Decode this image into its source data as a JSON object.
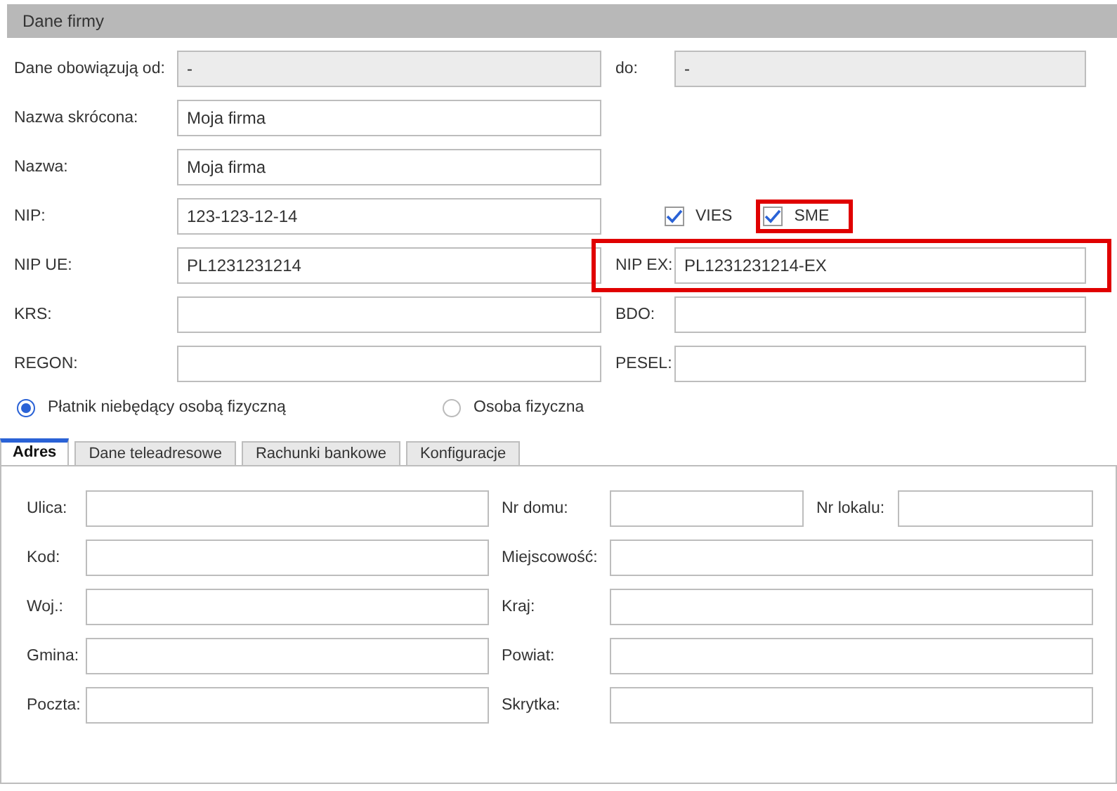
{
  "section_title": "Dane firmy",
  "rows": [
    {
      "items": [
        {
          "kind": "field",
          "label": "Dane obowiązują od:",
          "value": "-",
          "disabled": true
        },
        {
          "kind": "field",
          "label": "do:",
          "value": "-",
          "disabled": true
        }
      ]
    },
    {
      "items": [
        {
          "kind": "field",
          "label": "Nazwa skrócona:",
          "value": "Moja firma",
          "disabled": false
        }
      ]
    },
    {
      "items": [
        {
          "kind": "field",
          "label": "Nazwa:",
          "value": "Moja firma",
          "disabled": false
        }
      ]
    },
    {
      "items": [
        {
          "kind": "field",
          "label": "NIP:",
          "value": "123-123-12-14",
          "disabled": false
        },
        {
          "kind": "checks",
          "checks": [
            {
              "label": "VIES",
              "checked": true,
              "highlighted": false
            },
            {
              "label": "SME",
              "checked": true,
              "highlighted": true
            }
          ]
        }
      ]
    },
    {
      "items": [
        {
          "kind": "field",
          "label": "NIP UE:",
          "value": "PL1231231214",
          "disabled": false
        },
        {
          "kind": "field",
          "label": "NIP EX:",
          "value": "PL1231231214-EX",
          "disabled": false,
          "highlighted": true
        }
      ]
    },
    {
      "items": [
        {
          "kind": "field",
          "label": "KRS:",
          "disabled": false
        },
        {
          "kind": "field",
          "label": "BDO:",
          "disabled": false
        }
      ]
    },
    {
      "items": [
        {
          "kind": "field",
          "label": "REGON:",
          "disabled": false
        },
        {
          "kind": "field",
          "label": "PESEL:",
          "disabled": false
        }
      ]
    }
  ],
  "radios": [
    {
      "label": "Płatnik niebędący osobą fizyczną",
      "selected": true
    },
    {
      "label": "Osoba fizyczna",
      "selected": false
    }
  ],
  "tabs": [
    {
      "label": "Adres",
      "selected": true
    },
    {
      "label": "Dane teleadresowe",
      "selected": false
    },
    {
      "label": "Rachunki bankowe",
      "selected": false
    },
    {
      "label": "Konfiguracje",
      "selected": false
    }
  ],
  "address_rows": [
    {
      "fields": [
        {
          "label": "Ulica:"
        },
        {
          "label": "Nr domu:"
        },
        {
          "label": "Nr lokalu:"
        }
      ]
    },
    {
      "fields": [
        {
          "label": "Kod:"
        },
        {
          "label": "Miejscowość:"
        }
      ]
    },
    {
      "fields": [
        {
          "label": "Woj.:"
        },
        {
          "label": "Kraj:"
        }
      ]
    },
    {
      "fields": [
        {
          "label": "Gmina:"
        },
        {
          "label": "Powiat:"
        }
      ]
    },
    {
      "fields": [
        {
          "label": "Poczta:"
        },
        {
          "label": "Skrytka:"
        }
      ]
    }
  ]
}
